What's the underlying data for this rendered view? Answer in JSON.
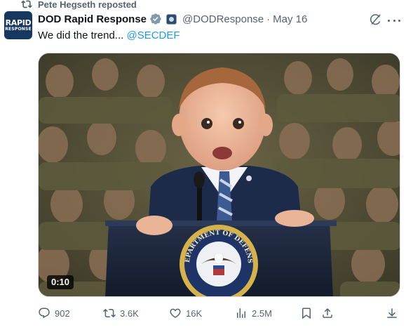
{
  "repost": {
    "text": "Pete Hegseth reposted",
    "icon": "repost-icon"
  },
  "author": {
    "avatar_text_top": "RAPID",
    "avatar_text_bottom": "RESPONSE",
    "name": "DOD Rapid Response",
    "handle": "@DODResponse",
    "separator": "·",
    "date": "May 16",
    "verified_color": "#829aab"
  },
  "tweet": {
    "text": "We did the trend...",
    "mention": "@SECDEF",
    "mention_color": "#1d9bf0"
  },
  "media": {
    "duration": "0:10",
    "podium_seal_text": "DEPARTMENT OF DEFENSE"
  },
  "actions": {
    "replies": "902",
    "reposts": "3.6K",
    "likes": "16K",
    "views": "2.5M"
  }
}
